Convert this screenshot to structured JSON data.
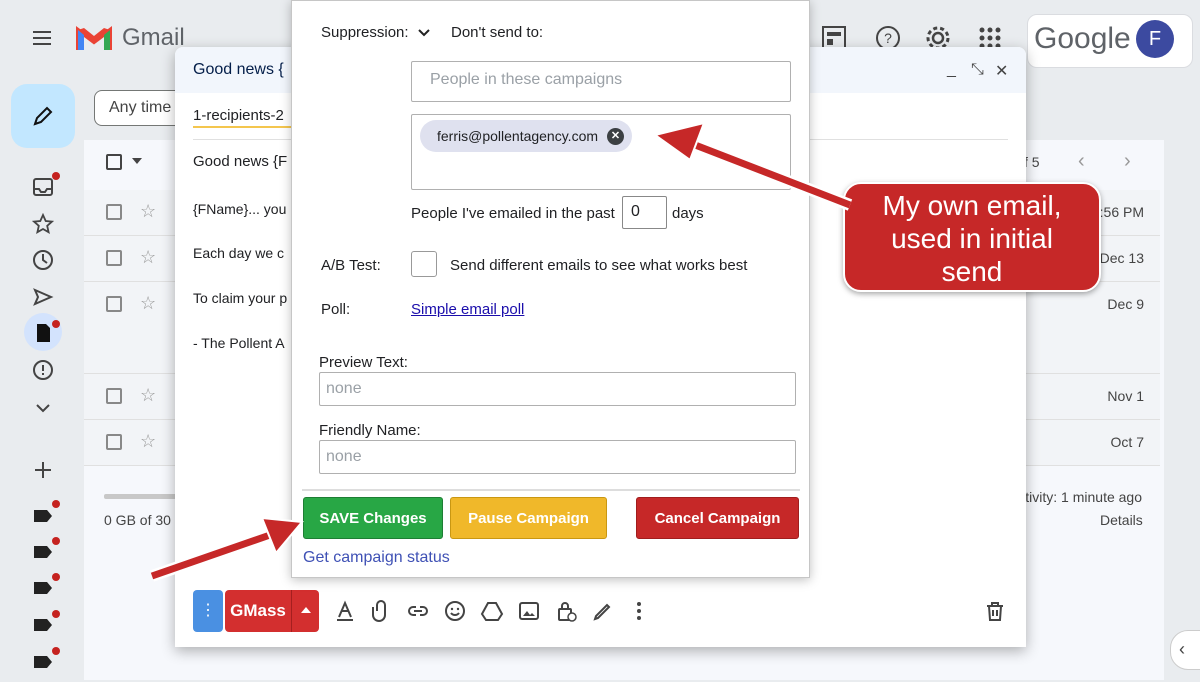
{
  "gmail": {
    "brand": "Gmail",
    "google_brand": "Google",
    "avatar_initial": "F",
    "anytime_filter": "Any time",
    "page_count_suffix": "f 5",
    "storage_text": "0 GB of 30",
    "activity_text": "tivity: 1 minute ago",
    "details_label": "Details",
    "rows": [
      {
        "date": ":56 PM"
      },
      {
        "date": "Dec 13"
      },
      {
        "date": "Dec 9"
      },
      {
        "date": "Nov 1"
      },
      {
        "date": "Oct 7"
      }
    ]
  },
  "compose": {
    "title": "Good news {",
    "recipients": "1-recipients-2",
    "subject": "Good news {F",
    "body_lines": [
      "{FName}... you",
      "Each day we c",
      "To claim your p",
      "- The Pollent A"
    ],
    "gmass_label": "GMass"
  },
  "panel": {
    "suppression_label": "Suppression:",
    "dont_send_label": "Don't send to:",
    "campaigns_placeholder": "People in these campaigns",
    "suppressed_email": "ferris@pollentagency.com",
    "emailed_past_label": "People I've emailed in the past",
    "days_value": "0",
    "days_label": "days",
    "ab_label": "A/B Test:",
    "ab_description": "Send different emails to see what works best",
    "poll_label": "Poll:",
    "poll_link": "Simple email poll",
    "preview_label": "Preview Text:",
    "preview_value": "none",
    "friendly_label": "Friendly Name:",
    "friendly_value": "none",
    "save_button": "SAVE Changes",
    "pause_button": "Pause Campaign",
    "cancel_button": "Cancel Campaign",
    "status_link": "Get campaign status"
  },
  "annotation": {
    "callout_line1": "My own email,",
    "callout_line2": "used in initial",
    "callout_line3": "send",
    "color": "#c62828"
  }
}
